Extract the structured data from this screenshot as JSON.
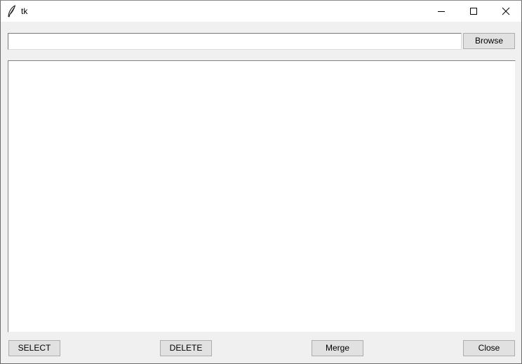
{
  "window": {
    "title": "tk",
    "app_icon": "tk-feather-icon",
    "controls": {
      "minimize_icon": "minimize-icon",
      "maximize_icon": "maximize-icon",
      "close_icon": "close-icon"
    }
  },
  "path_entry": {
    "value": "",
    "placeholder": ""
  },
  "buttons": {
    "browse": "Browse",
    "select": "SELECT",
    "delete": "DELETE",
    "merge": "Merge",
    "close": "Close"
  },
  "file_list": {
    "items": []
  },
  "colors": {
    "window_bg": "#f0f0f0",
    "titlebar_bg": "#ffffff",
    "button_bg": "#e1e1e1",
    "button_border": "#adadad",
    "list_bg": "#ffffff"
  }
}
